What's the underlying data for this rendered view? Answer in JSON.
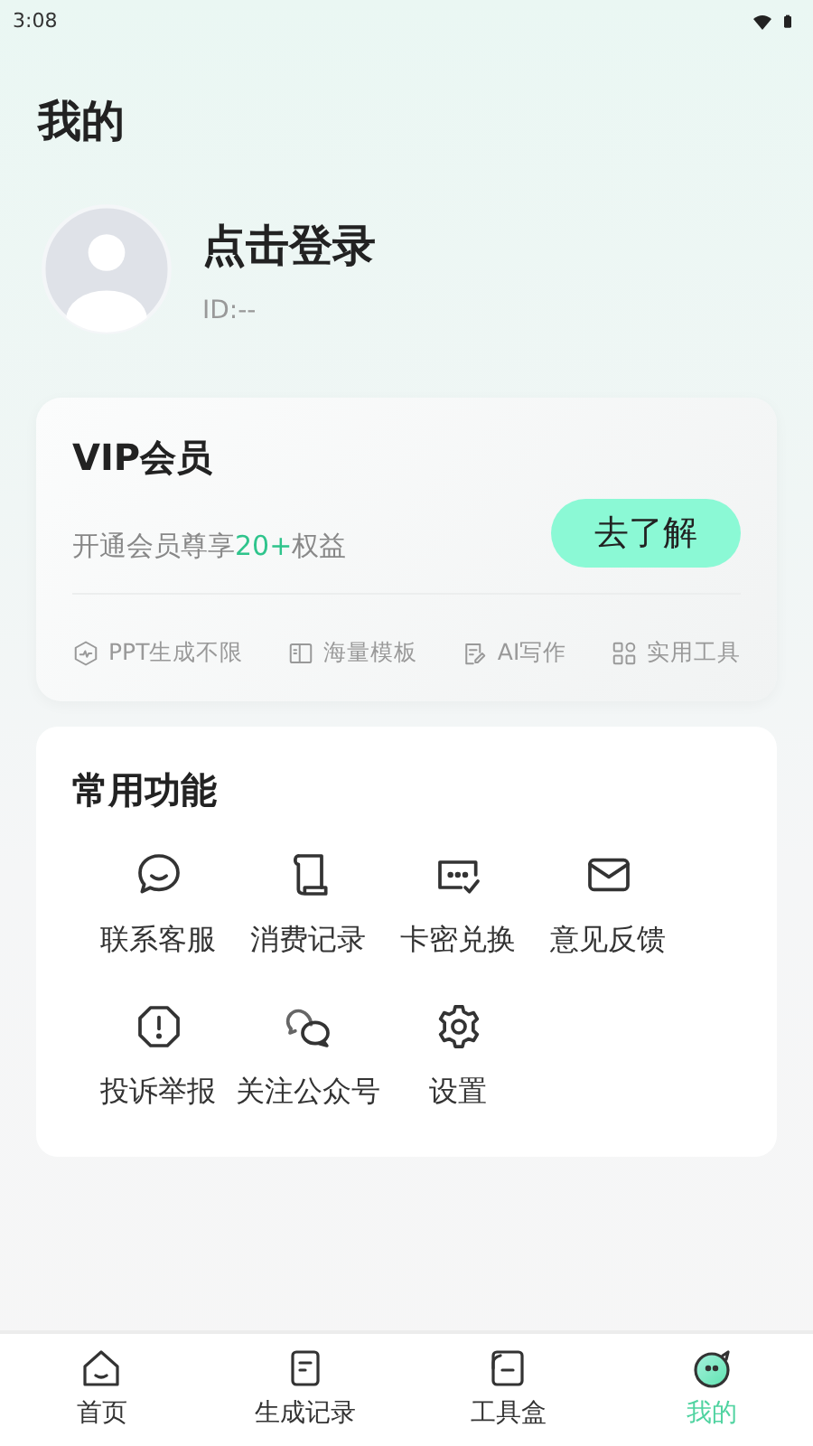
{
  "status_bar": {
    "time": "3:08"
  },
  "page_title": "我的",
  "profile": {
    "name": "点击登录",
    "id": "ID:--"
  },
  "vip_card": {
    "title": "VIP会员",
    "subtitle": [
      {
        "text": "开通会员尊享",
        "highlight": false
      },
      {
        "text": "20+",
        "highlight": true
      },
      {
        "text": "权益",
        "highlight": false
      }
    ],
    "button": "去了解",
    "benefits": [
      {
        "label": "PPT生成不限"
      },
      {
        "label": "海量模板"
      },
      {
        "label": "AI写作"
      },
      {
        "label": "实用工具"
      }
    ]
  },
  "functions": {
    "title": "常用功能",
    "items": [
      {
        "label": "联系客服"
      },
      {
        "label": "消费记录"
      },
      {
        "label": "卡密兑换"
      },
      {
        "label": "意见反馈"
      },
      {
        "label": "投诉举报"
      },
      {
        "label": "关注公众号"
      },
      {
        "label": "设置"
      }
    ]
  },
  "tabs": [
    {
      "label": "首页",
      "selected": false
    },
    {
      "label": "生成记录",
      "selected": false
    },
    {
      "label": "工具盒",
      "selected": false
    },
    {
      "label": "我的",
      "selected": true
    }
  ]
}
